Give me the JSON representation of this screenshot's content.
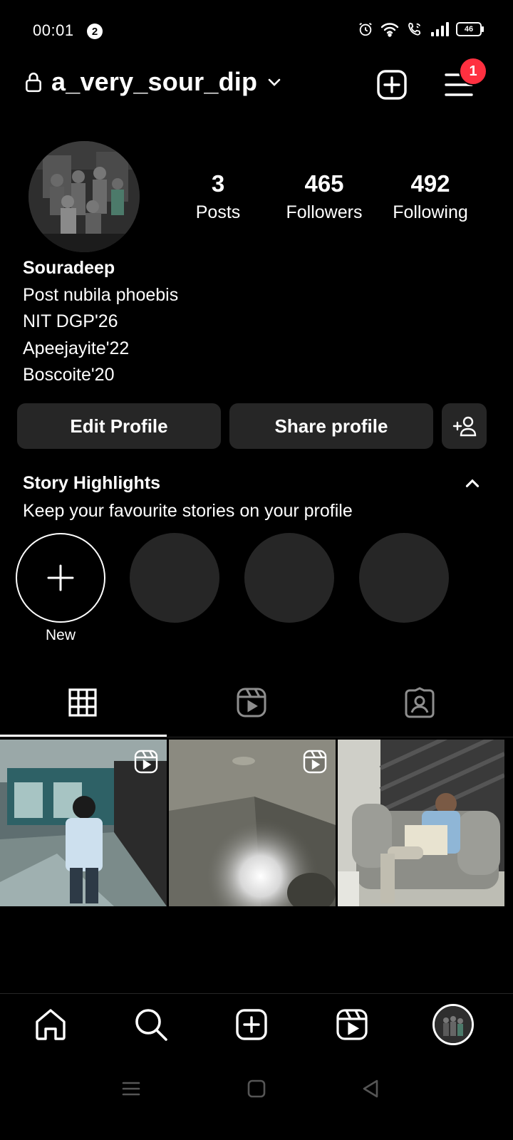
{
  "status_bar": {
    "time": "00:01",
    "notification_count": "2",
    "battery": "46",
    "icons": [
      "alarm-icon",
      "wifi-icon",
      "wifi-call-icon",
      "signal-icon",
      "battery-icon"
    ]
  },
  "header": {
    "username": "a_very_sour_dip",
    "menu_badge_count": "1",
    "icons": [
      "lock-icon",
      "chevron-down-icon",
      "create-plus-icon",
      "hamburger-menu-icon"
    ]
  },
  "profile": {
    "stats": [
      {
        "value": "3",
        "label": "Posts"
      },
      {
        "value": "465",
        "label": "Followers"
      },
      {
        "value": "492",
        "label": "Following"
      }
    ],
    "name": "Souradeep",
    "bio_lines": [
      "Post nubila phoebis",
      "NIT DGP'26",
      "Apeejayite'22",
      "Boscoite'20"
    ]
  },
  "actions": {
    "edit_profile": "Edit Profile",
    "share_profile": "Share profile"
  },
  "highlights": {
    "title": "Story Highlights",
    "subtitle": "Keep your favourite stories on your profile",
    "new_label": "New"
  },
  "tabs": [
    "grid-icon",
    "reels-icon",
    "tagged-icon"
  ],
  "bottom_nav": [
    "home-icon",
    "search-icon",
    "create-icon",
    "reels-icon",
    "profile-avatar"
  ],
  "colors": {
    "background": "#000000",
    "surface": "#262626",
    "badge_red": "#ff3040",
    "text": "#ffffff"
  }
}
